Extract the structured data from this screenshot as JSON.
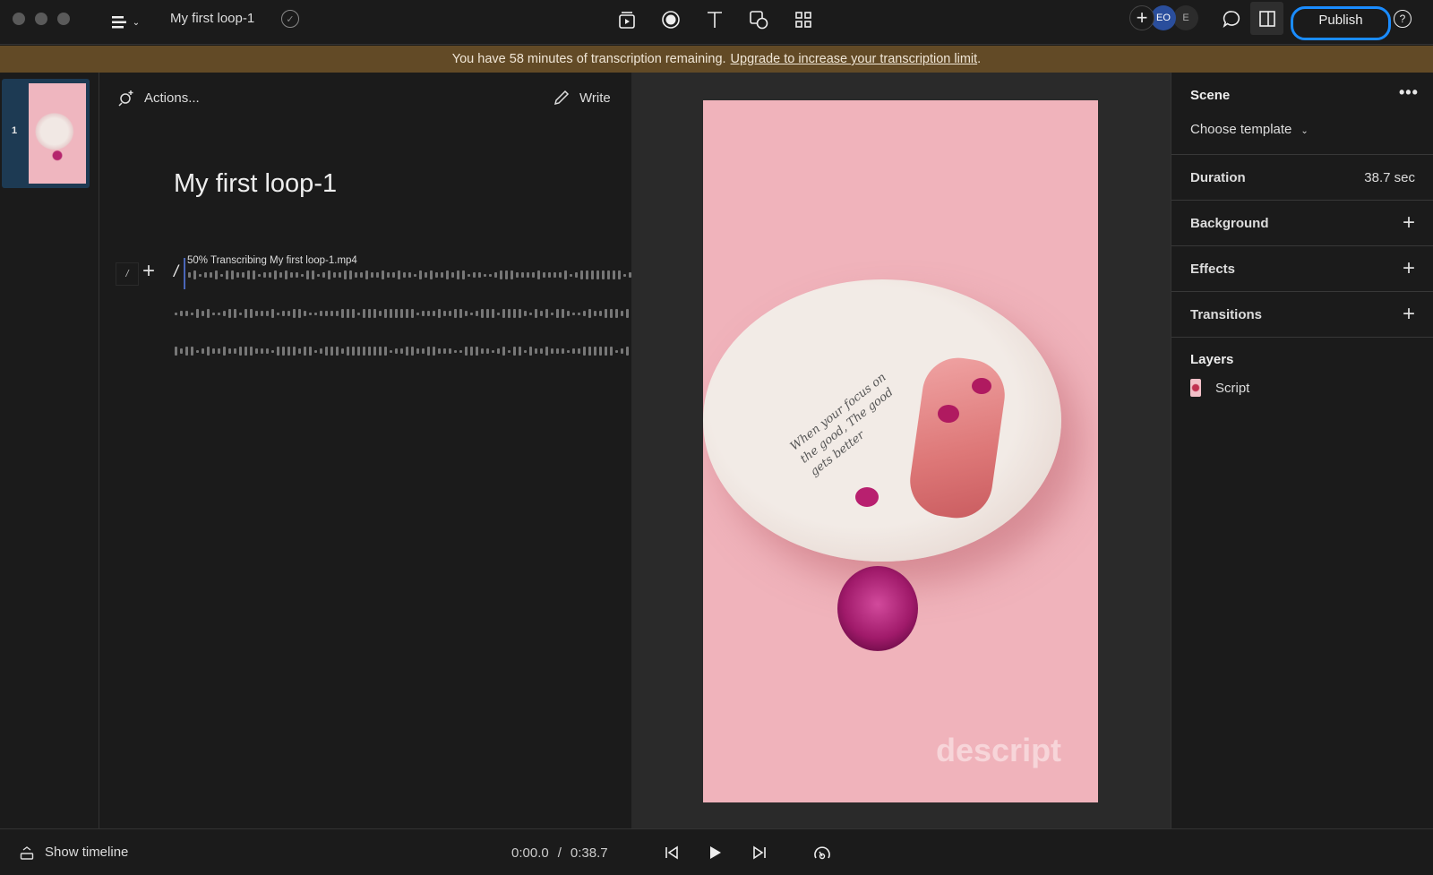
{
  "window": {
    "title": "My first loop-1"
  },
  "toolbar": {
    "publish_label": "Publish",
    "avatars": [
      "EO",
      "E"
    ],
    "accent": "#1a8cff"
  },
  "banner": {
    "text": "You have 58 minutes of transcription remaining.",
    "link": "Upgrade to increase your transcription limit",
    "period": "."
  },
  "scenes": [
    {
      "number": "1"
    }
  ],
  "script": {
    "actions_label": "Actions...",
    "write_label": "Write",
    "title": "My first loop-1",
    "slash": "/",
    "status": "50% Transcribing My first loop-1.mp4",
    "progress_percent": 50
  },
  "preview": {
    "watermark": "descript",
    "handwriting": "When your focus on the good, The good gets better"
  },
  "panel": {
    "scene_label": "Scene",
    "template_label": "Choose template",
    "duration_label": "Duration",
    "duration_value": "38.7 sec",
    "background_label": "Background",
    "effects_label": "Effects",
    "transitions_label": "Transitions",
    "layers_label": "Layers",
    "layers": [
      {
        "name": "Script"
      }
    ]
  },
  "bottom": {
    "show_timeline": "Show timeline",
    "current_time": "0:00.0",
    "separator": "/",
    "total_time": "0:38.7"
  }
}
